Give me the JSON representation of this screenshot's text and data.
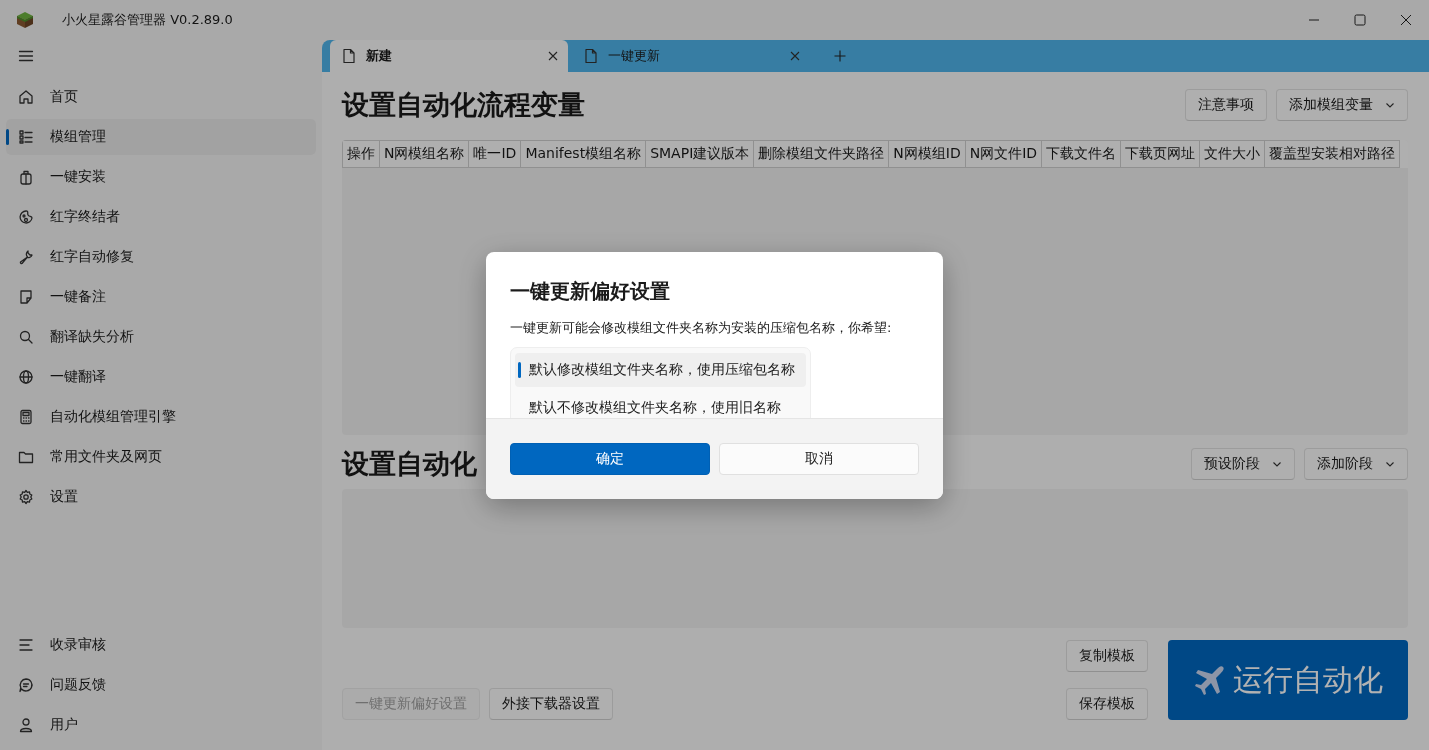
{
  "window": {
    "title": "小火星露谷管理器 V0.2.89.0"
  },
  "sidebar": {
    "items": [
      {
        "label": "首页",
        "selected": false
      },
      {
        "label": "模组管理",
        "selected": true
      },
      {
        "label": "一键安装",
        "selected": false
      },
      {
        "label": "红字终结者",
        "selected": false
      },
      {
        "label": "红字自动修复",
        "selected": false
      },
      {
        "label": "一键备注",
        "selected": false
      },
      {
        "label": "翻译缺失分析",
        "selected": false
      },
      {
        "label": "一键翻译",
        "selected": false
      },
      {
        "label": "自动化模组管理引擎",
        "selected": false
      },
      {
        "label": "常用文件夹及网页",
        "selected": false
      },
      {
        "label": "设置",
        "selected": false
      }
    ],
    "footer_items": [
      {
        "label": "收录审核",
        "selected": false
      },
      {
        "label": "问题反馈",
        "selected": false
      },
      {
        "label": "用户",
        "selected": false
      }
    ]
  },
  "tabs": [
    {
      "label": "新建",
      "selected": true
    },
    {
      "label": "一键更新",
      "selected": false
    }
  ],
  "variables_section": {
    "title": "设置自动化流程变量",
    "buttons": [
      {
        "label": "注意事项",
        "dropdown": false
      },
      {
        "label": "添加模组变量",
        "dropdown": true
      }
    ],
    "table": {
      "columns": [
        "操作",
        "N网模组名称",
        "唯一ID",
        "Manifest模组名称",
        "SMAPI建议版本",
        "删除模组文件夹路径",
        "N网模组ID",
        "N网文件ID",
        "下载文件名",
        "下载页网址",
        "文件大小",
        "覆盖型安装相对路径"
      ]
    }
  },
  "stages_section": {
    "title": "设置自动化",
    "buttons": [
      {
        "label": "预设阶段",
        "dropdown": true
      },
      {
        "label": "添加阶段",
        "dropdown": true
      }
    ]
  },
  "footer": {
    "left_buttons": [
      {
        "label": "一键更新偏好设置",
        "disabled": true
      },
      {
        "label": "外接下载器设置",
        "disabled": false
      }
    ],
    "template_buttons": [
      "复制模板",
      "保存模板"
    ],
    "run_button": "运行自动化"
  },
  "dialog": {
    "title": "一键更新偏好设置",
    "message": "一键更新可能会修改模组文件夹名称为安装的压缩包名称，你希望:",
    "options": [
      {
        "label": "默认修改模组文件夹名称，使用压缩包名称",
        "selected": true
      },
      {
        "label": "默认不修改模组文件夹名称，使用旧名称",
        "selected": false
      }
    ],
    "buttons": [
      {
        "label": "确定",
        "kind": "primary"
      },
      {
        "label": "取消",
        "kind": "secondary"
      }
    ]
  }
}
